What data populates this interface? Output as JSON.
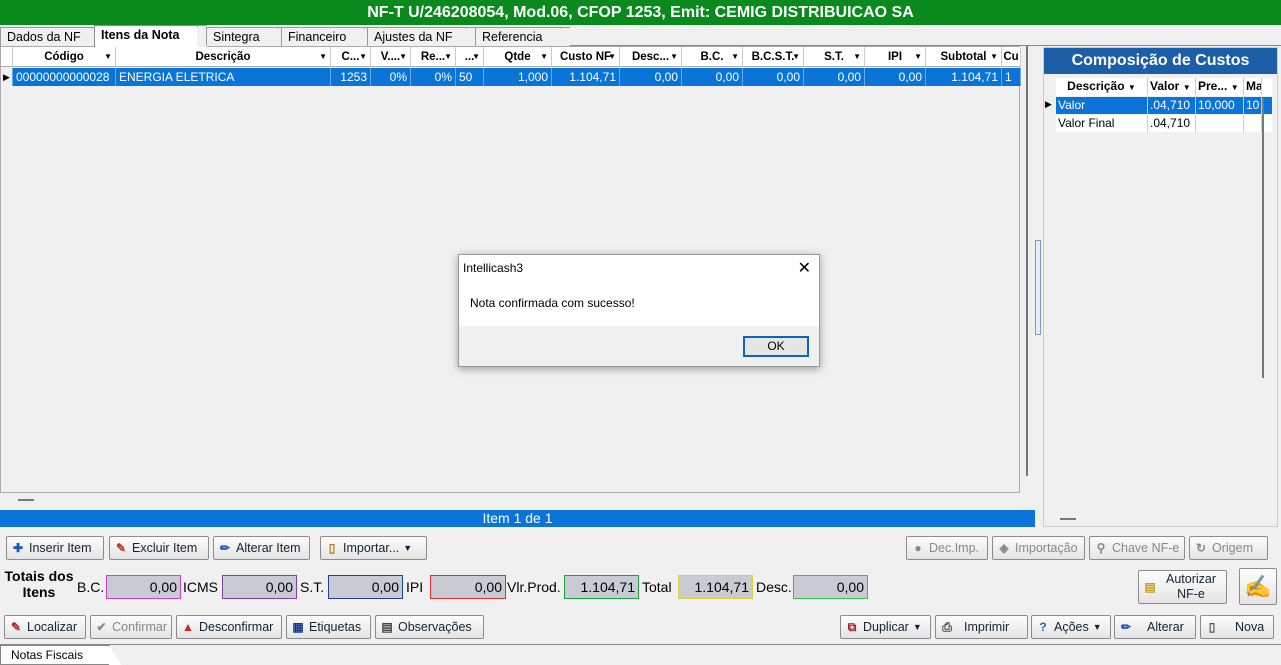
{
  "window": {
    "title": "NF-T U/246208054, Mod.06, CFOP 1253, Emit: CEMIG DISTRIBUICAO SA"
  },
  "tabs": [
    "Dados da NF",
    "Itens da Nota",
    "Sintegra",
    "Financeiro",
    "Ajustes da NF",
    "Referencia"
  ],
  "active_tab": "Itens da Nota",
  "grid": {
    "columns": [
      "Código",
      "Descrição",
      "C...",
      "V....",
      "Re...",
      "...",
      "Qtde",
      "Custo NF",
      "Desc...",
      "B.C.",
      "B.C.S.T.",
      "S.T.",
      "IPI",
      "Subtotal",
      "Cu"
    ],
    "rows": [
      [
        "00000000000028",
        "ENERGIA ELETRICA",
        "1253",
        "0%",
        "0%",
        "50",
        "1,000",
        "1.104,71",
        "0,00",
        "0,00",
        "0,00",
        "0,00",
        "0,00",
        "1.104,71",
        "1"
      ]
    ]
  },
  "status": "Item 1 de 1",
  "composicao": {
    "title": "Composição de Custos",
    "columns": [
      "Descrição",
      "Valor",
      "Pre...",
      "Ma"
    ],
    "rows": [
      [
        "Valor",
        ".04,710",
        "10,000",
        "10"
      ],
      [
        "Valor Final",
        ".04,710",
        "",
        ""
      ]
    ]
  },
  "item_buttons": {
    "inserir": "Inserir Item",
    "excluir": "Excluir Item",
    "alterar": "Alterar Item",
    "importar": "Importar..."
  },
  "right_buttons": {
    "dec_imp": "Dec.Imp.",
    "importacao": "Importação",
    "chave": "Chave NF-e",
    "origem": "Origem"
  },
  "totals": {
    "label": "Totais dos Itens",
    "bc_label": "B.C.",
    "bc": "0,00",
    "icms_label": "ICMS",
    "icms": "0,00",
    "st_label": "S.T.",
    "st": "0,00",
    "ipi_label": "IPI",
    "ipi": "0,00",
    "vlprod_label": "Vlr.Prod.",
    "vlprod": "1.104,71",
    "total_label": "Total",
    "total": "1.104,71",
    "desc_label": "Desc.",
    "desc": "0,00"
  },
  "autorizar": "Autorizar NF-e",
  "bottom_buttons": {
    "localizar": "Localizar",
    "confirmar": "Confirmar",
    "desconfirmar": "Desconfirmar",
    "etiquetas": "Etiquetas",
    "observacoes": "Observações",
    "duplicar": "Duplicar",
    "imprimir": "Imprimir",
    "acoes": "Ações",
    "alterar": "Alterar",
    "nova": "Nova"
  },
  "bottom_tab": "Notas Fiscais",
  "dialog": {
    "title": "Intellicash3",
    "message": "Nota confirmada com sucesso!",
    "ok": "OK"
  }
}
